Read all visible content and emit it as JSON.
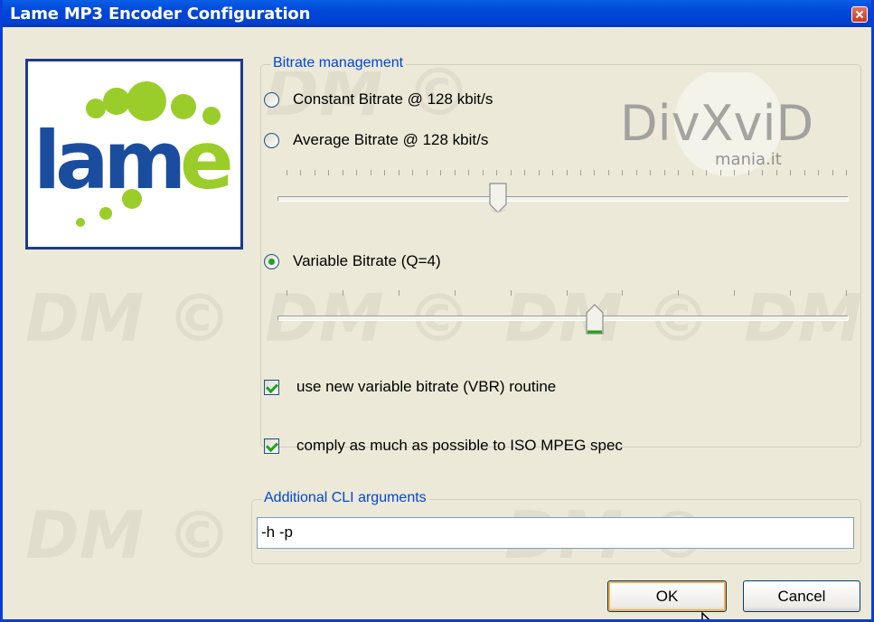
{
  "window": {
    "title": "Lame MP3 Encoder Configuration"
  },
  "watermark": {
    "text": "DM ©"
  },
  "logo": {
    "text": "lame"
  },
  "divxvid_logo": {
    "title": "DivXviD",
    "subtitle": "mania.it"
  },
  "bitrate_group": {
    "legend": "Bitrate management",
    "options": [
      {
        "label": "Constant Bitrate @ 128 kbit/s",
        "selected": false
      },
      {
        "label": "Average Bitrate @ 128 kbit/s",
        "selected": false
      },
      {
        "label": "Variable Bitrate (Q=4)",
        "selected": true
      }
    ],
    "average_slider": {
      "tick_count": 40,
      "value_fraction": 0.39
    },
    "vbr_slider": {
      "tick_count": 10,
      "value_index": 5
    },
    "vbr_checkbox": {
      "label": "use new variable bitrate (VBR) routine",
      "checked": true
    }
  },
  "iso_checkbox": {
    "label": "comply as much as possible to ISO MPEG spec",
    "checked": true
  },
  "cli_group": {
    "legend": "Additional CLI arguments",
    "value": "-h -p"
  },
  "buttons": {
    "ok": "OK",
    "cancel": "Cancel"
  },
  "colors": {
    "title_bar": "#0147d9",
    "accent_green": "#21a121",
    "legend_blue": "#0046d5",
    "dialog_bg": "#ece9d8"
  }
}
